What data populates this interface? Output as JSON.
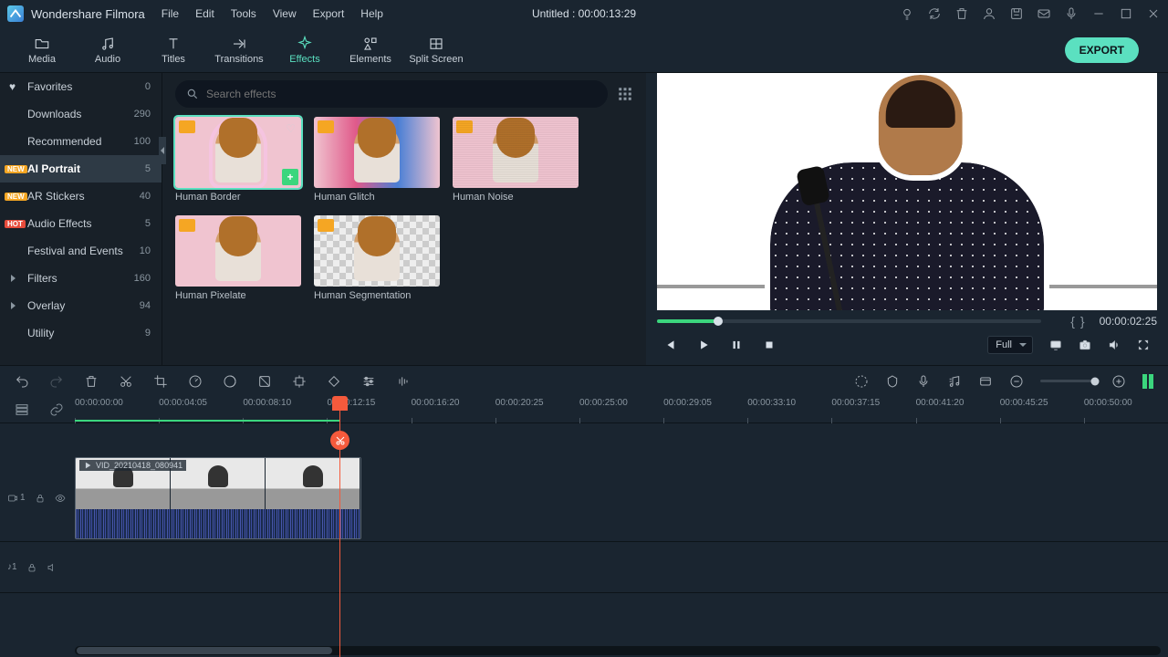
{
  "app": {
    "name": "Wondershare Filmora",
    "doc_title": "Untitled : 00:00:13:29"
  },
  "menu": [
    "File",
    "Edit",
    "Tools",
    "View",
    "Export",
    "Help"
  ],
  "tabs": {
    "media": "Media",
    "audio": "Audio",
    "titles": "Titles",
    "transitions": "Transitions",
    "effects": "Effects",
    "elements": "Elements",
    "split": "Split Screen",
    "export": "EXPORT"
  },
  "sidebar": [
    {
      "label": "Favorites",
      "count": "0"
    },
    {
      "label": "Downloads",
      "count": "290"
    },
    {
      "label": "Recommended",
      "count": "100"
    },
    {
      "label": "AI Portrait",
      "count": "5"
    },
    {
      "label": "AR Stickers",
      "count": "40"
    },
    {
      "label": "Audio Effects",
      "count": "5"
    },
    {
      "label": "Festival and Events",
      "count": "10"
    },
    {
      "label": "Filters",
      "count": "160"
    },
    {
      "label": "Overlay",
      "count": "94"
    },
    {
      "label": "Utility",
      "count": "9"
    }
  ],
  "badges": {
    "new": "NEW",
    "hot": "HOT"
  },
  "search": {
    "placeholder": "Search effects"
  },
  "effects": [
    {
      "name": "Human Border"
    },
    {
      "name": "Human Glitch"
    },
    {
      "name": "Human Noise"
    },
    {
      "name": "Human Pixelate"
    },
    {
      "name": "Human Segmentation"
    }
  ],
  "preview": {
    "timecode": "00:00:02:25",
    "resolution": "Full",
    "marker_in": "{",
    "marker_out": "}"
  },
  "timeline": {
    "clip_name": "VID_20210418_080941",
    "video_track": "1",
    "audio_track": "♪1",
    "ticks": [
      "00:00:00:00",
      "00:00:04:05",
      "00:00:08:10",
      "00:00:12:15",
      "00:00:16:20",
      "00:00:20:25",
      "00:00:25:00",
      "00:00:29:05",
      "00:00:33:10",
      "00:00:37:15",
      "00:00:41:20",
      "00:00:45:25",
      "00:00:50:00"
    ]
  }
}
